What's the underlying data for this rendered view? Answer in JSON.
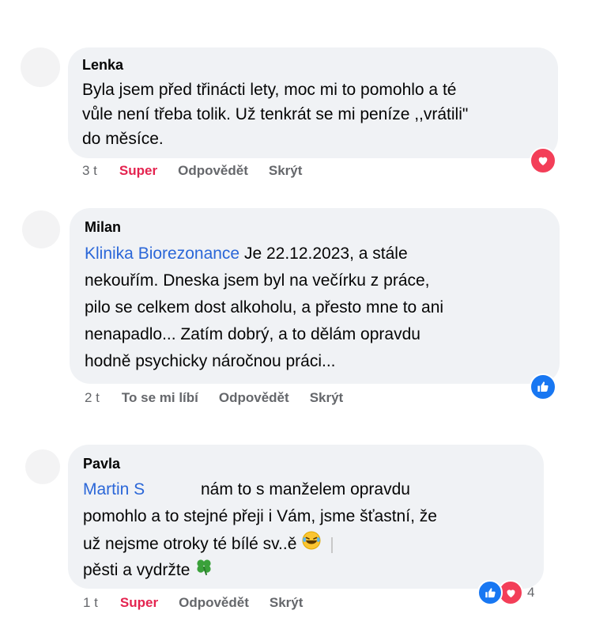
{
  "comments": [
    {
      "author": "Lenka",
      "lines": [
        "Byla jsem před třinácti lety, moc mi to pomohlo a té",
        "vůle není třeba tolik. Už tenkrát se mi peníze ,,vrátili\"",
        "do měsíce."
      ],
      "time": "3 t",
      "reaction_label": "Super",
      "reply_label": "Odpovědět",
      "hide_label": "Skrýt",
      "reaction_icon": "heart-icon"
    },
    {
      "author": "Milan",
      "mention": "Klinika Biorezonance",
      "lines": [
        " Je 22.12.2023, a stále",
        "nekouřím. Dneska jsem byl na večírku z práce,",
        "pilo se celkem dost alkoholu, a přesto mne to ani",
        "nenapadlo... Zatím dobrý, a to dělám opravdu",
        "hodně psychicky náročnou práci..."
      ],
      "time": "2 t",
      "reaction_label": "To se mi líbí",
      "reply_label": "Odpovědět",
      "hide_label": "Skrýt",
      "reaction_icon": "like-icon"
    },
    {
      "author": "Pavla",
      "mention": "Martin S",
      "lines": [
        "nám to s manželem opravdu",
        "pomohlo a to stejné přeji i Vám, jsme šťastní, že",
        "už nejsme otroky té bílé sv..ě",
        "pěsti a vydržte"
      ],
      "time": "1 t",
      "reaction_label": "Super",
      "reply_label": "Odpovědět",
      "hide_label": "Skrýt",
      "reaction_count": "4",
      "reaction_icons": [
        "like-icon",
        "heart-icon"
      ]
    }
  ],
  "colors": {
    "bubble": "#f0f2f5",
    "mention": "#2b67d8",
    "super": "#e4234f",
    "meta": "#65676b",
    "like": "#1877f2"
  }
}
